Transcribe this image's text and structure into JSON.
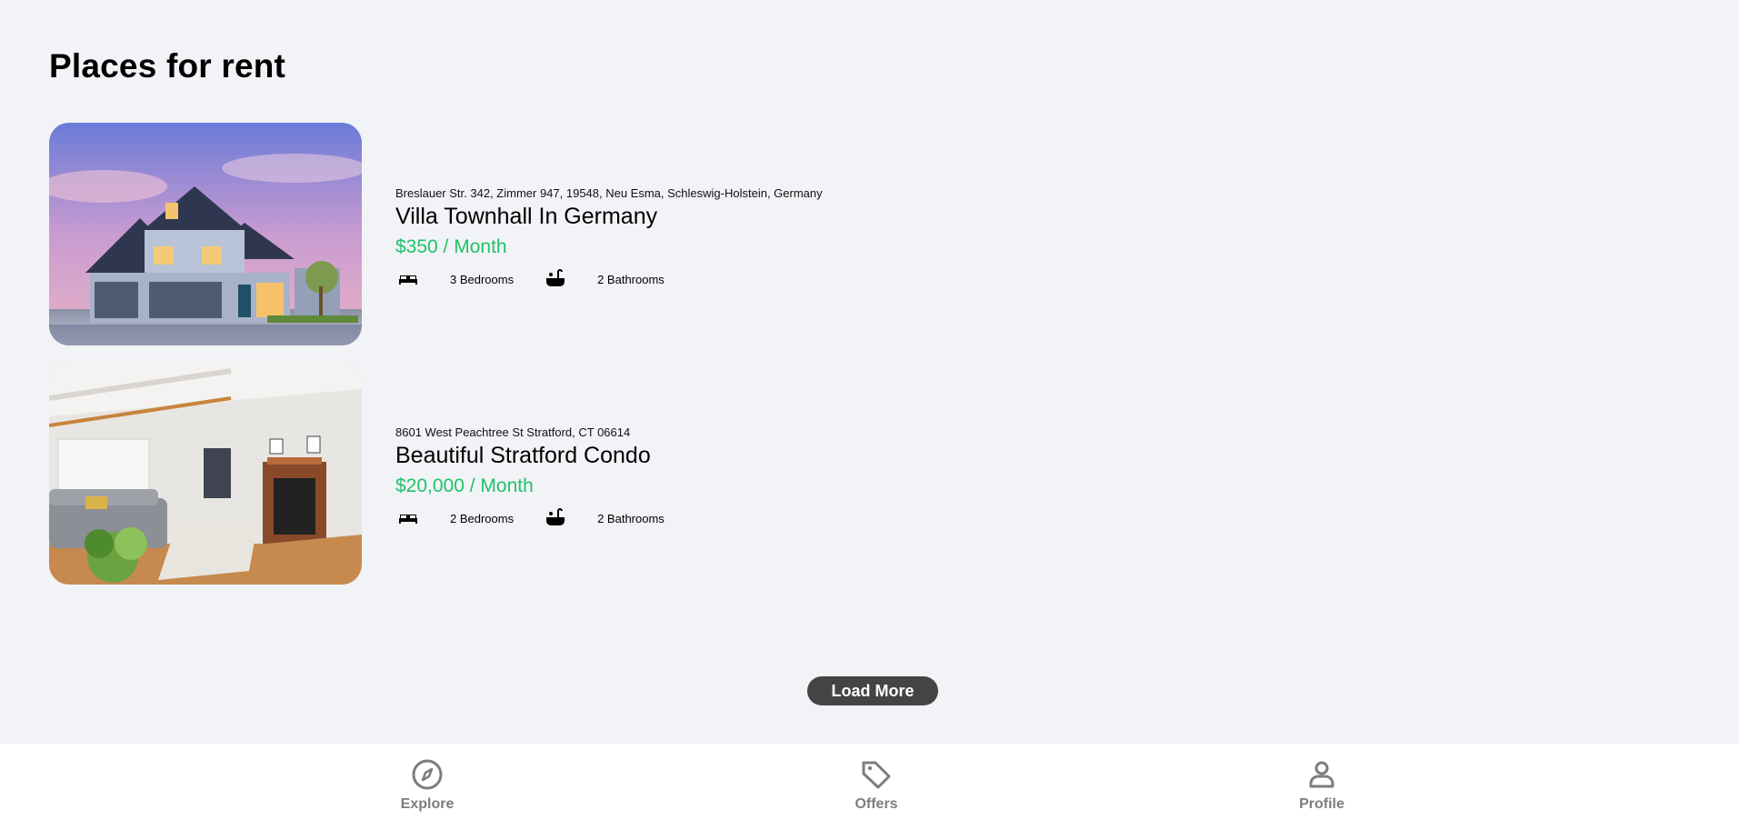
{
  "page": {
    "title": "Places for rent"
  },
  "listings": [
    {
      "address": "Breslauer Str. 342, Zimmer 947, 19548, Neu Esma, Schleswig-Holstein, Germany",
      "name": "Villa Townhall In Germany",
      "price": "$350 / Month",
      "bedrooms": "3 Bedrooms",
      "bathrooms": "2 Bathrooms",
      "image": "house-exterior-photo"
    },
    {
      "address": "8601 West Peachtree St Stratford, CT 06614",
      "name": "Beautiful Stratford Condo",
      "price": "$20,000 / Month",
      "bedrooms": "2 Bedrooms",
      "bathrooms": "2 Bathrooms",
      "image": "living-room-photo"
    }
  ],
  "load_more": {
    "label": "Load More"
  },
  "nav": {
    "explore": {
      "label": "Explore",
      "icon": "compass-icon"
    },
    "offers": {
      "label": "Offers",
      "icon": "tag-icon"
    },
    "profile": {
      "label": "Profile",
      "icon": "person-icon"
    }
  },
  "colors": {
    "background": "#f2f3f7",
    "price": "#1fc36a",
    "button": "#444444",
    "nav_text": "#7d7d7d"
  }
}
